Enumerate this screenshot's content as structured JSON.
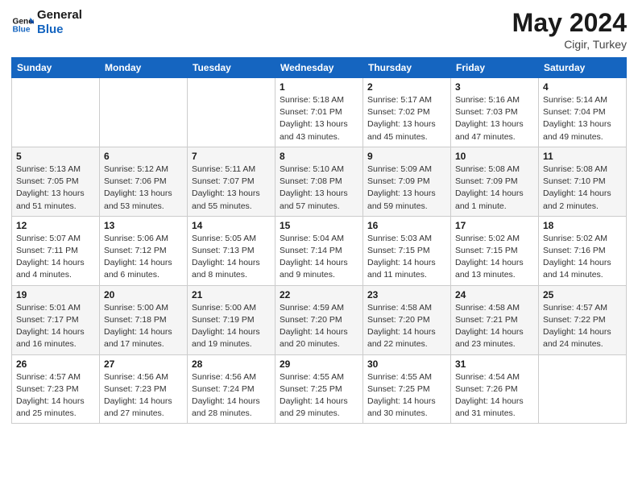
{
  "header": {
    "logo_line1": "General",
    "logo_line2": "Blue",
    "month_year": "May 2024",
    "location": "Cigir, Turkey"
  },
  "weekdays": [
    "Sunday",
    "Monday",
    "Tuesday",
    "Wednesday",
    "Thursday",
    "Friday",
    "Saturday"
  ],
  "weeks": [
    [
      {
        "day": "",
        "info": ""
      },
      {
        "day": "",
        "info": ""
      },
      {
        "day": "",
        "info": ""
      },
      {
        "day": "1",
        "info": "Sunrise: 5:18 AM\nSunset: 7:01 PM\nDaylight: 13 hours and 43 minutes."
      },
      {
        "day": "2",
        "info": "Sunrise: 5:17 AM\nSunset: 7:02 PM\nDaylight: 13 hours and 45 minutes."
      },
      {
        "day": "3",
        "info": "Sunrise: 5:16 AM\nSunset: 7:03 PM\nDaylight: 13 hours and 47 minutes."
      },
      {
        "day": "4",
        "info": "Sunrise: 5:14 AM\nSunset: 7:04 PM\nDaylight: 13 hours and 49 minutes."
      }
    ],
    [
      {
        "day": "5",
        "info": "Sunrise: 5:13 AM\nSunset: 7:05 PM\nDaylight: 13 hours and 51 minutes."
      },
      {
        "day": "6",
        "info": "Sunrise: 5:12 AM\nSunset: 7:06 PM\nDaylight: 13 hours and 53 minutes."
      },
      {
        "day": "7",
        "info": "Sunrise: 5:11 AM\nSunset: 7:07 PM\nDaylight: 13 hours and 55 minutes."
      },
      {
        "day": "8",
        "info": "Sunrise: 5:10 AM\nSunset: 7:08 PM\nDaylight: 13 hours and 57 minutes."
      },
      {
        "day": "9",
        "info": "Sunrise: 5:09 AM\nSunset: 7:09 PM\nDaylight: 13 hours and 59 minutes."
      },
      {
        "day": "10",
        "info": "Sunrise: 5:08 AM\nSunset: 7:09 PM\nDaylight: 14 hours and 1 minute."
      },
      {
        "day": "11",
        "info": "Sunrise: 5:08 AM\nSunset: 7:10 PM\nDaylight: 14 hours and 2 minutes."
      }
    ],
    [
      {
        "day": "12",
        "info": "Sunrise: 5:07 AM\nSunset: 7:11 PM\nDaylight: 14 hours and 4 minutes."
      },
      {
        "day": "13",
        "info": "Sunrise: 5:06 AM\nSunset: 7:12 PM\nDaylight: 14 hours and 6 minutes."
      },
      {
        "day": "14",
        "info": "Sunrise: 5:05 AM\nSunset: 7:13 PM\nDaylight: 14 hours and 8 minutes."
      },
      {
        "day": "15",
        "info": "Sunrise: 5:04 AM\nSunset: 7:14 PM\nDaylight: 14 hours and 9 minutes."
      },
      {
        "day": "16",
        "info": "Sunrise: 5:03 AM\nSunset: 7:15 PM\nDaylight: 14 hours and 11 minutes."
      },
      {
        "day": "17",
        "info": "Sunrise: 5:02 AM\nSunset: 7:15 PM\nDaylight: 14 hours and 13 minutes."
      },
      {
        "day": "18",
        "info": "Sunrise: 5:02 AM\nSunset: 7:16 PM\nDaylight: 14 hours and 14 minutes."
      }
    ],
    [
      {
        "day": "19",
        "info": "Sunrise: 5:01 AM\nSunset: 7:17 PM\nDaylight: 14 hours and 16 minutes."
      },
      {
        "day": "20",
        "info": "Sunrise: 5:00 AM\nSunset: 7:18 PM\nDaylight: 14 hours and 17 minutes."
      },
      {
        "day": "21",
        "info": "Sunrise: 5:00 AM\nSunset: 7:19 PM\nDaylight: 14 hours and 19 minutes."
      },
      {
        "day": "22",
        "info": "Sunrise: 4:59 AM\nSunset: 7:20 PM\nDaylight: 14 hours and 20 minutes."
      },
      {
        "day": "23",
        "info": "Sunrise: 4:58 AM\nSunset: 7:20 PM\nDaylight: 14 hours and 22 minutes."
      },
      {
        "day": "24",
        "info": "Sunrise: 4:58 AM\nSunset: 7:21 PM\nDaylight: 14 hours and 23 minutes."
      },
      {
        "day": "25",
        "info": "Sunrise: 4:57 AM\nSunset: 7:22 PM\nDaylight: 14 hours and 24 minutes."
      }
    ],
    [
      {
        "day": "26",
        "info": "Sunrise: 4:57 AM\nSunset: 7:23 PM\nDaylight: 14 hours and 25 minutes."
      },
      {
        "day": "27",
        "info": "Sunrise: 4:56 AM\nSunset: 7:23 PM\nDaylight: 14 hours and 27 minutes."
      },
      {
        "day": "28",
        "info": "Sunrise: 4:56 AM\nSunset: 7:24 PM\nDaylight: 14 hours and 28 minutes."
      },
      {
        "day": "29",
        "info": "Sunrise: 4:55 AM\nSunset: 7:25 PM\nDaylight: 14 hours and 29 minutes."
      },
      {
        "day": "30",
        "info": "Sunrise: 4:55 AM\nSunset: 7:25 PM\nDaylight: 14 hours and 30 minutes."
      },
      {
        "day": "31",
        "info": "Sunrise: 4:54 AM\nSunset: 7:26 PM\nDaylight: 14 hours and 31 minutes."
      },
      {
        "day": "",
        "info": ""
      }
    ]
  ]
}
